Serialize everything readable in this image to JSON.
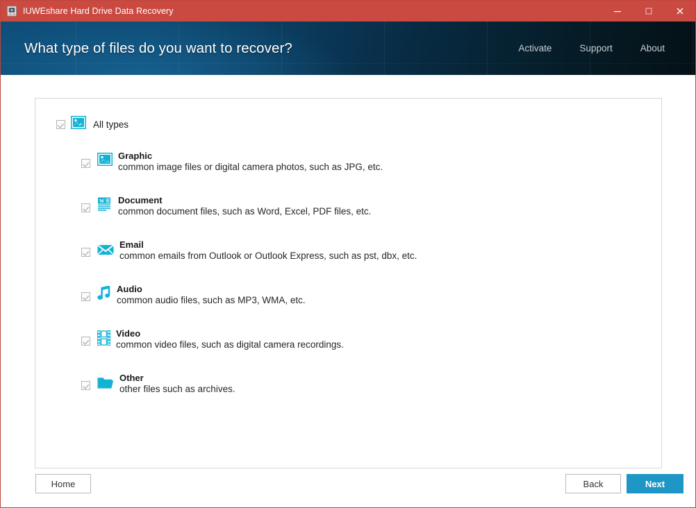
{
  "window": {
    "title": "IUWEshare Hard Drive Data Recovery",
    "app_icon": "hard-drive-icon",
    "border_color": "#c0453c",
    "titlebar_color": "#ca4a42",
    "controls": {
      "minimize": "minimize-icon",
      "maximize": "maximize-icon",
      "close": "close-icon"
    }
  },
  "header": {
    "title": "What type of files do you want to recover?",
    "accent_color": "#0d4e78",
    "nav": [
      {
        "label": "Activate"
      },
      {
        "label": "Support"
      },
      {
        "label": "About"
      }
    ]
  },
  "main": {
    "all_types": {
      "label": "All types",
      "checked": true,
      "icon": "picture-icon"
    },
    "types": [
      {
        "name": "Graphic",
        "description": "common image files or digital camera photos, such as JPG, etc.",
        "icon": "picture-icon",
        "checked": true
      },
      {
        "name": "Document",
        "description": "common document files, such as Word, Excel, PDF files, etc.",
        "icon": "document-icon",
        "checked": true
      },
      {
        "name": "Email",
        "description": "common emails from Outlook or Outlook Express, such as pst, dbx, etc.",
        "icon": "envelope-icon",
        "checked": true
      },
      {
        "name": "Audio",
        "description": "common audio files, such as MP3, WMA, etc.",
        "icon": "music-note-icon",
        "checked": true
      },
      {
        "name": "Video",
        "description": "common video files, such as digital camera recordings.",
        "icon": "film-strip-icon",
        "checked": true
      },
      {
        "name": "Other",
        "description": "other files such as archives.",
        "icon": "folder-icon",
        "checked": true
      }
    ],
    "icon_color": "#13b3d6"
  },
  "footer": {
    "home_label": "Home",
    "back_label": "Back",
    "next_label": "Next",
    "next_color": "#1f97c6"
  }
}
